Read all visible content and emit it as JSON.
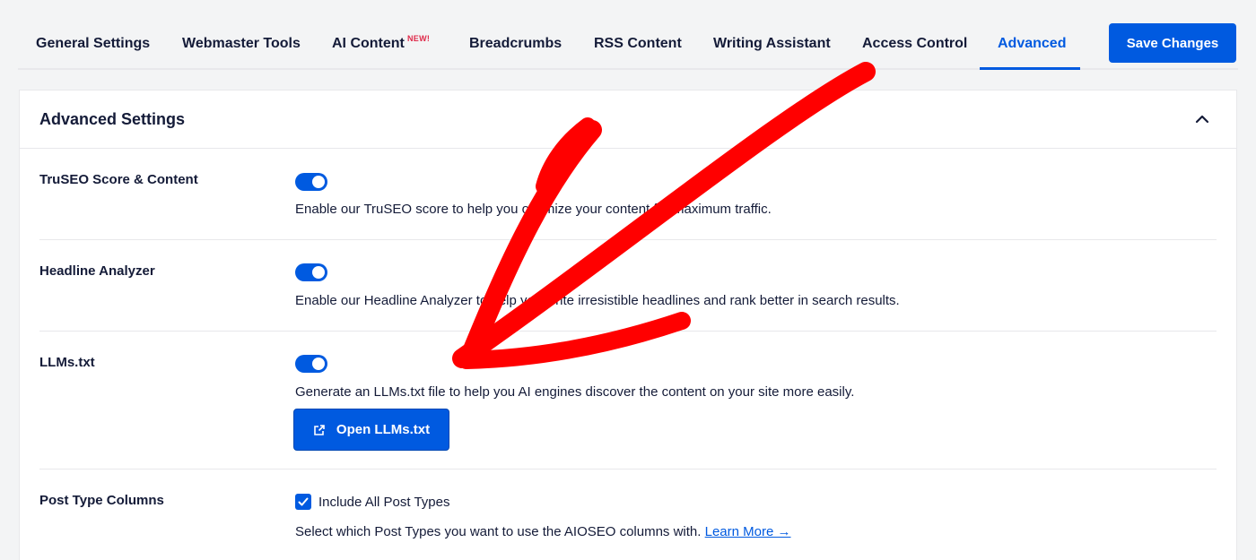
{
  "tabs": [
    {
      "label": "General Settings",
      "active": false
    },
    {
      "label": "Webmaster Tools",
      "active": false
    },
    {
      "label": "AI Content",
      "badge": "NEW!",
      "active": false
    },
    {
      "label": "Breadcrumbs",
      "active": false
    },
    {
      "label": "RSS Content",
      "active": false
    },
    {
      "label": "Writing Assistant",
      "active": false
    },
    {
      "label": "Access Control",
      "active": false
    },
    {
      "label": "Advanced",
      "active": true
    }
  ],
  "save_button": {
    "label": "Save Changes"
  },
  "panel": {
    "title": "Advanced Settings",
    "collapse_icon": "chevron-up-icon",
    "rows": [
      {
        "label": "TruSEO Score & Content",
        "toggle_on": true,
        "description": "Enable our TruSEO score to help you optimize your content for maximum traffic."
      },
      {
        "label": "Headline Analyzer",
        "toggle_on": true,
        "description": "Enable our Headline Analyzer to help you write irresistible headlines and rank better in search results."
      },
      {
        "label": "LLMs.txt",
        "toggle_on": true,
        "description": "Generate an LLMs.txt file to help you AI engines discover the content on your site more easily.",
        "button_label": "Open LLMs.txt",
        "button_icon": "external-link-icon"
      },
      {
        "label": "Post Type Columns",
        "checkbox_checked": true,
        "checkbox_label": "Include All Post Types",
        "description": "Select which Post Types you want to use the AIOSEO columns with.",
        "link_label": "Learn More →"
      }
    ]
  },
  "colors": {
    "accent": "#005ae0",
    "badge": "#df2a4a",
    "annotation_arrow": "#ff0000",
    "text": "#141b38"
  }
}
